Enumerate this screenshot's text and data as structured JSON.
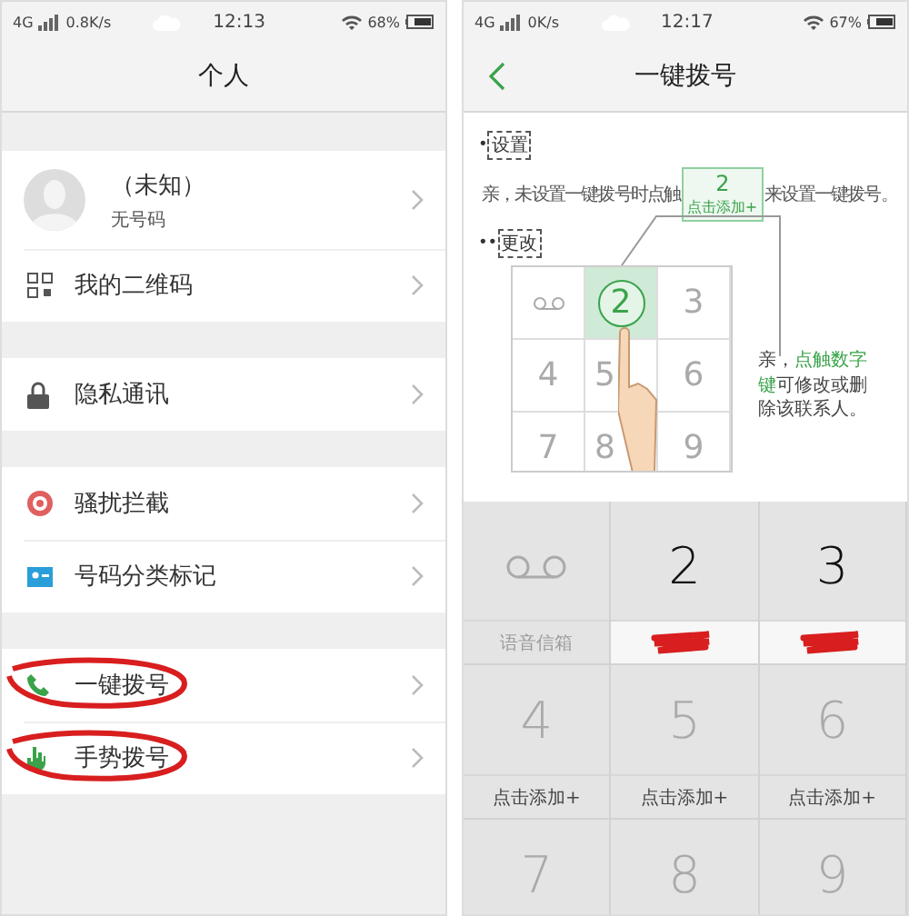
{
  "left": {
    "status": {
      "network": "4G",
      "speed": "0.8K/s",
      "time": "12:13",
      "battery": "68%"
    },
    "title": "个人",
    "groups": [
      [
        {
          "kind": "profile",
          "label": "（未知）",
          "sub": "无号码",
          "circled": false
        },
        {
          "kind": "qr",
          "label": "我的二维码",
          "circled": false
        }
      ],
      [
        {
          "kind": "lock",
          "label": "隐私通讯",
          "circled": false
        }
      ],
      [
        {
          "kind": "shield",
          "label": "骚扰拦截",
          "circled": false
        },
        {
          "kind": "tag",
          "label": "号码分类标记",
          "circled": false
        }
      ],
      [
        {
          "kind": "phone",
          "label": "一键拨号",
          "circled": true
        },
        {
          "kind": "hand",
          "label": "手势拨号",
          "circled": true
        }
      ]
    ]
  },
  "right": {
    "status": {
      "network": "4G",
      "speed": "0K/s",
      "time": "12:17",
      "battery": "67%"
    },
    "title": "一键拨号",
    "guide": {
      "set_bullet": "•",
      "set_heading": "设置",
      "set_before": "亲，未设置一键拨号时点触",
      "sample_digit": "2",
      "sample_label": "点击添加+",
      "set_after": "来设置一键拨号。",
      "change_bullet": "••",
      "change_heading": "更改",
      "mini_keys": [
        {
          "kind": "voicemail",
          "selected": false
        },
        {
          "kind": "digit",
          "digit": "2",
          "selected": true
        },
        {
          "kind": "digit",
          "digit": "3",
          "selected": false
        },
        {
          "kind": "digit",
          "digit": "4",
          "selected": false
        },
        {
          "kind": "digit",
          "digit": "5",
          "selected": false
        },
        {
          "kind": "digit",
          "digit": "6",
          "selected": false
        },
        {
          "kind": "digit",
          "digit": "7",
          "selected": false
        },
        {
          "kind": "digit",
          "digit": "8",
          "selected": false
        },
        {
          "kind": "digit",
          "digit": "9",
          "selected": false
        }
      ],
      "callout": "亲，**点触数字键**可修改或删除该联系人。"
    },
    "key_rows": [
      [
        {
          "kind": "voicemail",
          "label": "语音信箱"
        },
        {
          "kind": "digit",
          "digit": "2",
          "assigned": true,
          "scribbled": true
        },
        {
          "kind": "digit",
          "digit": "3",
          "assigned": true,
          "scribbled": true
        }
      ],
      [
        {
          "kind": "digit",
          "digit": "4",
          "label": "点击添加+",
          "assigned": false,
          "scribbled": false
        },
        {
          "kind": "digit",
          "digit": "5",
          "label": "点击添加+",
          "assigned": false,
          "scribbled": false
        },
        {
          "kind": "digit",
          "digit": "6",
          "label": "点击添加+",
          "assigned": false,
          "scribbled": false
        }
      ],
      [
        {
          "kind": "digit",
          "digit": "7",
          "assigned": false
        },
        {
          "kind": "digit",
          "digit": "8",
          "assigned": false
        },
        {
          "kind": "digit",
          "digit": "9",
          "assigned": false
        }
      ]
    ]
  }
}
